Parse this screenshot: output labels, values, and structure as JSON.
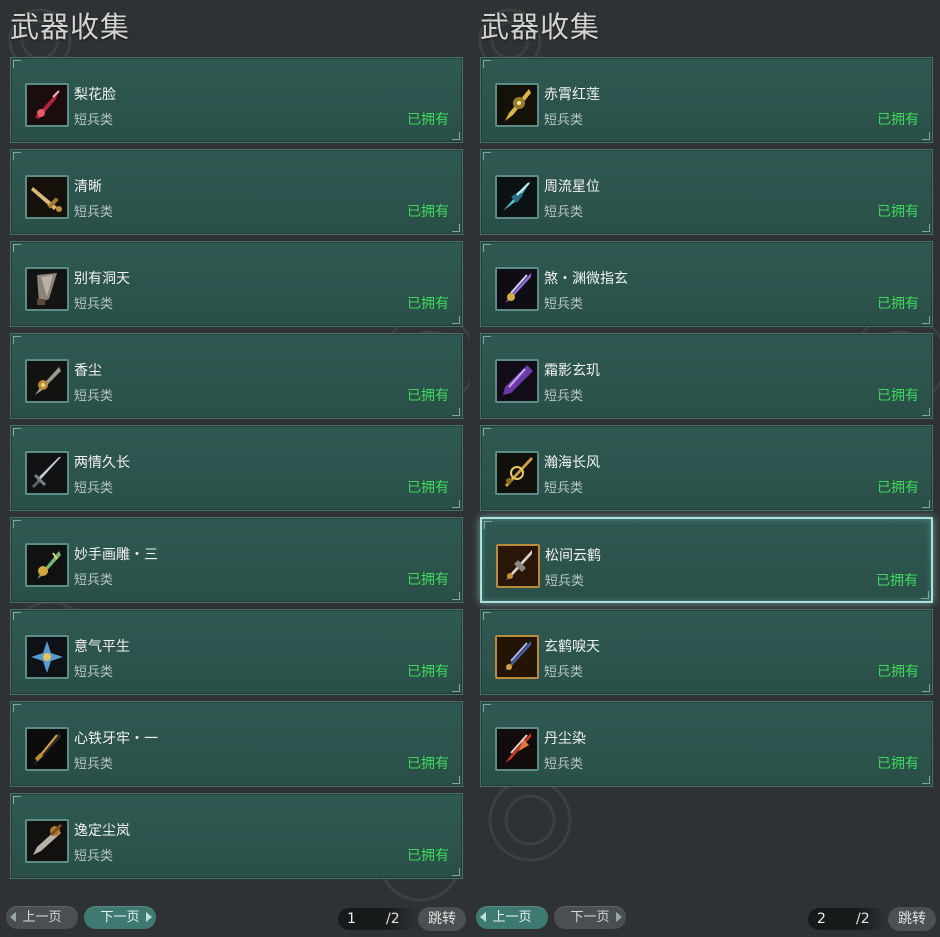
{
  "left_panel": {
    "title": "武器收集",
    "items": [
      {
        "name": "梨花脸",
        "type": "短兵类",
        "status": "已拥有",
        "icon": "red-dagger-icon"
      },
      {
        "name": "清晰",
        "type": "短兵类",
        "status": "已拥有",
        "icon": "gold-dagger-icon"
      },
      {
        "name": "别有洞天",
        "type": "短兵类",
        "status": "已拥有",
        "icon": "stone-blade-icon"
      },
      {
        "name": "香尘",
        "type": "短兵类",
        "status": "已拥有",
        "icon": "bronze-blade-icon"
      },
      {
        "name": "两情久长",
        "type": "短兵类",
        "status": "已拥有",
        "icon": "silver-dagger-icon"
      },
      {
        "name": "妙手画雕・三",
        "type": "短兵类",
        "status": "已拥有",
        "icon": "green-gold-blade-icon"
      },
      {
        "name": "意气平生",
        "type": "短兵类",
        "status": "已拥有",
        "icon": "blue-star-blade-icon"
      },
      {
        "name": "心铁牙牢・一",
        "type": "短兵类",
        "status": "已拥有",
        "icon": "black-gold-dagger-icon"
      },
      {
        "name": "逸定尘岚",
        "type": "短兵类",
        "status": "已拥有",
        "icon": "bronze-cleaver-icon"
      }
    ],
    "pager": {
      "prev": "上一页",
      "next": "下一页",
      "page": "1",
      "total": "/2",
      "jump": "跳转"
    }
  },
  "right_panel": {
    "title": "武器收集",
    "items": [
      {
        "name": "赤霄红莲",
        "type": "短兵类",
        "status": "已拥有",
        "icon": "golden-ornate-blade-icon"
      },
      {
        "name": "周流星位",
        "type": "短兵类",
        "status": "已拥有",
        "icon": "cyan-spear-blade-icon"
      },
      {
        "name": "煞・渊微指玄",
        "type": "短兵类",
        "status": "已拥有",
        "icon": "violet-blade-icon"
      },
      {
        "name": "霜影玄玑",
        "type": "短兵类",
        "status": "已拥有",
        "icon": "purple-blade-icon"
      },
      {
        "name": "瀚海长风",
        "type": "短兵类",
        "status": "已拥有",
        "icon": "gold-twin-blade-icon"
      },
      {
        "name": "松间云鹤",
        "type": "短兵类",
        "status": "已拥有",
        "icon": "crane-blade-icon",
        "selected": true
      },
      {
        "name": "玄鹤唳天",
        "type": "短兵类",
        "status": "已拥有",
        "icon": "dark-crane-blade-icon"
      },
      {
        "name": "丹尘染",
        "type": "短兵类",
        "status": "已拥有",
        "icon": "red-flame-blade-icon"
      }
    ],
    "pager": {
      "prev": "上一页",
      "next": "下一页",
      "page": "2",
      "total": "/2",
      "jump": "跳转"
    }
  },
  "colors": {
    "background": "#2e3234",
    "card": "#2d554f",
    "owned_text": "#3ed95a",
    "selected_border": "#a8e2dc",
    "active_button": "#3f7a72"
  }
}
